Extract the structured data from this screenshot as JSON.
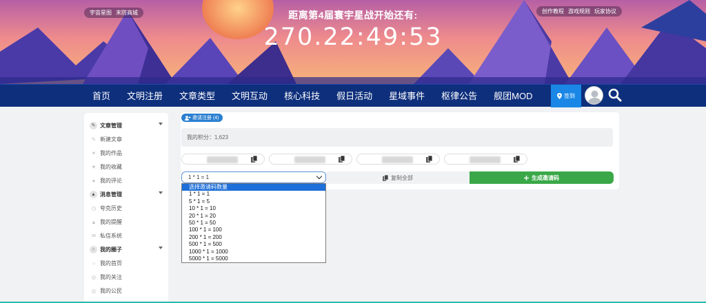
{
  "top_left_links": [
    "宇宙星图",
    "末防商城"
  ],
  "top_right_links": [
    "创作教程",
    "游戏规则",
    "玩家协议"
  ],
  "countdown": {
    "title": "距离第4届寰宇星战开始还有:",
    "time": "270.22:49:53"
  },
  "nav": {
    "items": [
      "首页",
      "文明注册",
      "文章类型",
      "文明互动",
      "核心科技",
      "假日活动",
      "星域事件",
      "枢律公告",
      "舰团MOD"
    ],
    "checkin": "签到"
  },
  "sidebar": {
    "groups": [
      {
        "label": "文章管理",
        "icon": "pencil-icon",
        "items": [
          {
            "label": "新建文章",
            "icon": "edit-icon"
          },
          {
            "label": "我的作品",
            "icon": "pin-icon"
          },
          {
            "label": "我的收藏",
            "icon": "heart-icon"
          },
          {
            "label": "我的评论",
            "icon": "comment-icon"
          }
        ]
      },
      {
        "label": "消息管理",
        "icon": "bell-icon",
        "items": [
          {
            "label": "夸克历史",
            "icon": "history-icon"
          },
          {
            "label": "我的提醒",
            "icon": "bell-icon"
          },
          {
            "label": "私信系统",
            "icon": "mail-icon"
          }
        ]
      },
      {
        "label": "我的圈子",
        "icon": "circle-icon",
        "items": [
          {
            "label": "我的首页",
            "icon": "home-icon"
          },
          {
            "label": "我的关注",
            "icon": "users-icon"
          },
          {
            "label": "我的公民",
            "icon": "group-icon"
          }
        ]
      }
    ]
  },
  "invite": {
    "tag": "邀请注册 (4)",
    "points": "我的积分：1,623",
    "select_value": "1 * 1 = 1",
    "copy_all": "复制全部",
    "generate": "生成邀请码",
    "options": [
      "选择邀请码数量",
      "1 * 1 = 1",
      "5 * 1 = 5",
      "10 * 1 = 10",
      "20 * 1 = 20",
      "50 * 1 = 50",
      "100 * 1 = 100",
      "200 * 1 = 200",
      "500 * 1 = 500",
      "1000 * 1 = 1000",
      "5000 * 1 = 5000"
    ]
  },
  "colors": {
    "navbar": "#0e2f7c",
    "checkin": "#1a87e6",
    "generate": "#3aa848",
    "selected_option": "#1e6fd9"
  }
}
